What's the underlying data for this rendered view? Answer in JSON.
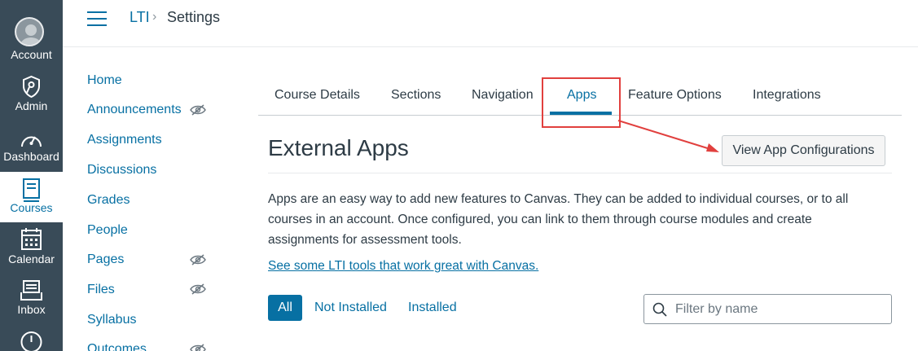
{
  "global_nav": {
    "items": [
      {
        "label": "Account",
        "icon": "user-avatar-icon"
      },
      {
        "label": "Admin",
        "icon": "shield-icon"
      },
      {
        "label": "Dashboard",
        "icon": "dashboard-gauge-icon"
      },
      {
        "label": "Courses",
        "icon": "book-icon",
        "active": true
      },
      {
        "label": "Calendar",
        "icon": "calendar-icon"
      },
      {
        "label": "Inbox",
        "icon": "inbox-icon"
      },
      {
        "label": "",
        "icon": "clock-icon"
      }
    ]
  },
  "header": {
    "breadcrumb": {
      "course": "LTI",
      "separator": "›",
      "current": "Settings"
    }
  },
  "course_nav": {
    "items": [
      {
        "label": "Home",
        "hidden": false
      },
      {
        "label": "Announcements",
        "hidden": true
      },
      {
        "label": "Assignments",
        "hidden": false
      },
      {
        "label": "Discussions",
        "hidden": false
      },
      {
        "label": "Grades",
        "hidden": false
      },
      {
        "label": "People",
        "hidden": false
      },
      {
        "label": "Pages",
        "hidden": true
      },
      {
        "label": "Files",
        "hidden": true
      },
      {
        "label": "Syllabus",
        "hidden": false
      },
      {
        "label": "Outcomes",
        "hidden": true
      }
    ]
  },
  "tabs": {
    "items": [
      "Course Details",
      "Sections",
      "Navigation",
      "Apps",
      "Feature Options",
      "Integrations"
    ],
    "active": "Apps"
  },
  "external_apps": {
    "title": "External Apps",
    "view_config_button": "View App Configurations",
    "description": "Apps are an easy way to add new features to Canvas. They can be added to individual courses, or to all courses in an account. Once configured, you can link to them through course modules and create assignments for assessment tools.",
    "lti_link": "See some LTI tools that work great with Canvas.",
    "filters": {
      "all": "All",
      "not_installed": "Not Installed",
      "installed": "Installed"
    },
    "search_placeholder": "Filter by name"
  },
  "colors": {
    "nav_bg": "#394b58",
    "brand_blue": "#0770a3",
    "annotation_red": "#e1403e"
  }
}
